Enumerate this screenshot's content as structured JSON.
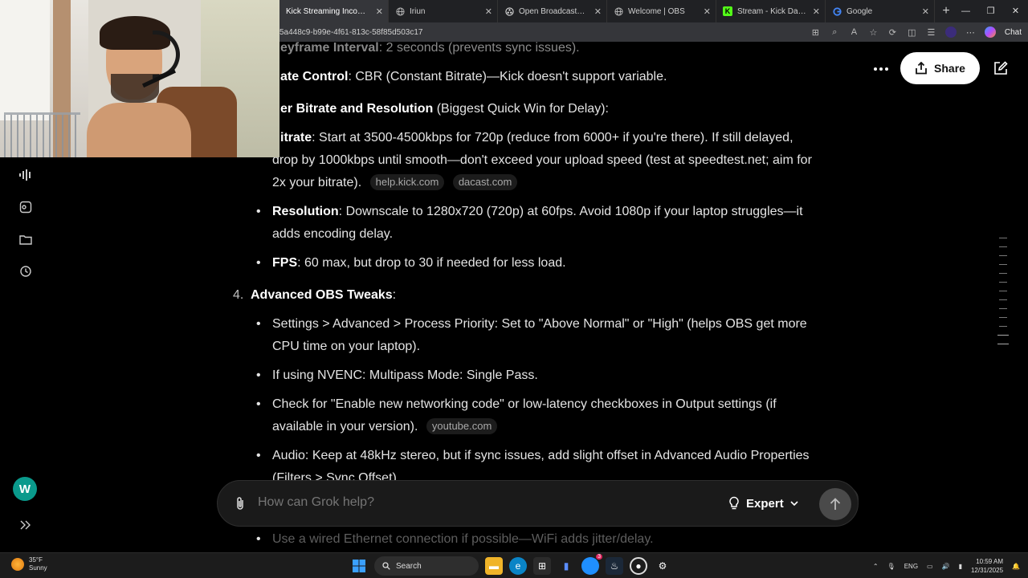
{
  "browser": {
    "tabs": [
      {
        "label": "Kick Streaming Income: Foll",
        "icon": "grok-icon"
      },
      {
        "label": "Iriun",
        "icon": "globe-icon"
      },
      {
        "label": "Open Broadcaster Software",
        "icon": "obs-icon"
      },
      {
        "label": "Welcome | OBS",
        "icon": "globe-icon"
      },
      {
        "label": "Stream - Kick Dashboard",
        "icon": "kick-icon"
      },
      {
        "label": "Google",
        "icon": "google-icon"
      }
    ],
    "url": "5a448c9-b99e-4f61-813c-58f85d503c17",
    "chat_label": "Chat"
  },
  "header": {
    "share_label": "Share"
  },
  "sidebar": {
    "avatar_letter": "W"
  },
  "content": {
    "line0_bold": "eyframe Interval",
    "line0_rest": ": 2 seconds (prevents sync issues).",
    "line1_bold": "ate Control",
    "line1_rest": ": CBR (Constant Bitrate)—Kick doesn't support variable.",
    "line2_bold": "er Bitrate and Resolution",
    "line2_rest": " (Biggest Quick Win for Delay):",
    "bitrate_bold": "itrate",
    "bitrate_l1": ": Start at 3500-4500kbps for 720p (reduce from 6000+ if you're there). If still delayed,",
    "bitrate_l2": "drop by 1000kbps until smooth—don't exceed your upload speed (test at speedtest.net; aim for",
    "bitrate_l3": "2x your bitrate).",
    "chip_help": "help.kick.com",
    "chip_dacast": "dacast.com",
    "res_bold": "Resolution",
    "res_l1": ": Downscale to 1280x720 (720p) at 60fps. Avoid 1080p if your laptop struggles—it",
    "res_l2": "adds encoding delay.",
    "fps_bold": "FPS",
    "fps_rest": ": 60 max, but drop to 30 if needed for less load.",
    "sec4_num": "4.",
    "sec4_bold": "Advanced OBS Tweaks",
    "sec4_colon": ":",
    "adv1_l1": "Settings > Advanced > Process Priority: Set to \"Above Normal\" or \"High\" (helps OBS get more",
    "adv1_l2": "CPU time on your laptop).",
    "adv2": "If using NVENC: Multipass Mode: Single Pass.",
    "adv3_l1": "Check for \"Enable new networking code\" or low-latency checkboxes in Output settings (if",
    "adv3_l2": "available in your version).",
    "chip_youtube": "youtube.com",
    "adv4_l1": "Audio: Keep at 48kHz stereo, but if sync issues, add slight offset in Advanced Audio Properties",
    "adv4_l2": "(Filters > Sync Offset).",
    "adv5": "Use a wired Ethernet connection if possible—WiFi adds jitter/delay."
  },
  "composer": {
    "placeholder": "How can Grok help?",
    "mode_label": "Expert"
  },
  "taskbar": {
    "temp": "35°F",
    "condition": "Sunny",
    "search_label": "Search",
    "lang": "ENG",
    "time": "10:59 AM",
    "date": "12/31/2025",
    "notif_badge": "3"
  },
  "colors": {
    "background": "#000000",
    "share_bg": "#ffffff",
    "avatar": "#0a9a8c",
    "kick_green": "#53fc18"
  }
}
